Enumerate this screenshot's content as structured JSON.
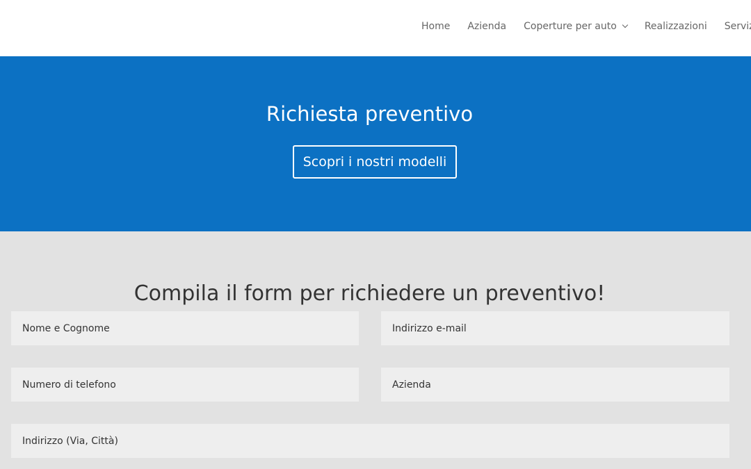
{
  "nav": {
    "items": [
      {
        "label": "Home",
        "has_dropdown": false
      },
      {
        "label": "Azienda",
        "has_dropdown": false
      },
      {
        "label": "Coperture per auto",
        "has_dropdown": true
      },
      {
        "label": "Realizzazioni",
        "has_dropdown": false
      },
      {
        "label": "Servizi",
        "has_dropdown": false
      }
    ]
  },
  "hero": {
    "title": "Richiesta preventivo",
    "button_label": "Scopri i nostri modelli",
    "background_color": "#0c71c3"
  },
  "form": {
    "title": "Compila il form per richiedere un preventivo!",
    "fields": {
      "name_placeholder": "Nome e Cognome",
      "email_placeholder": "Indirizzo e-mail",
      "phone_placeholder": "Numero di telefono",
      "company_placeholder": "Azienda",
      "address_placeholder": "Indirizzo (Via, Città)"
    }
  },
  "colors": {
    "page_background": "#e2e2e2",
    "field_background": "#eeeeee",
    "nav_text": "#666666"
  }
}
